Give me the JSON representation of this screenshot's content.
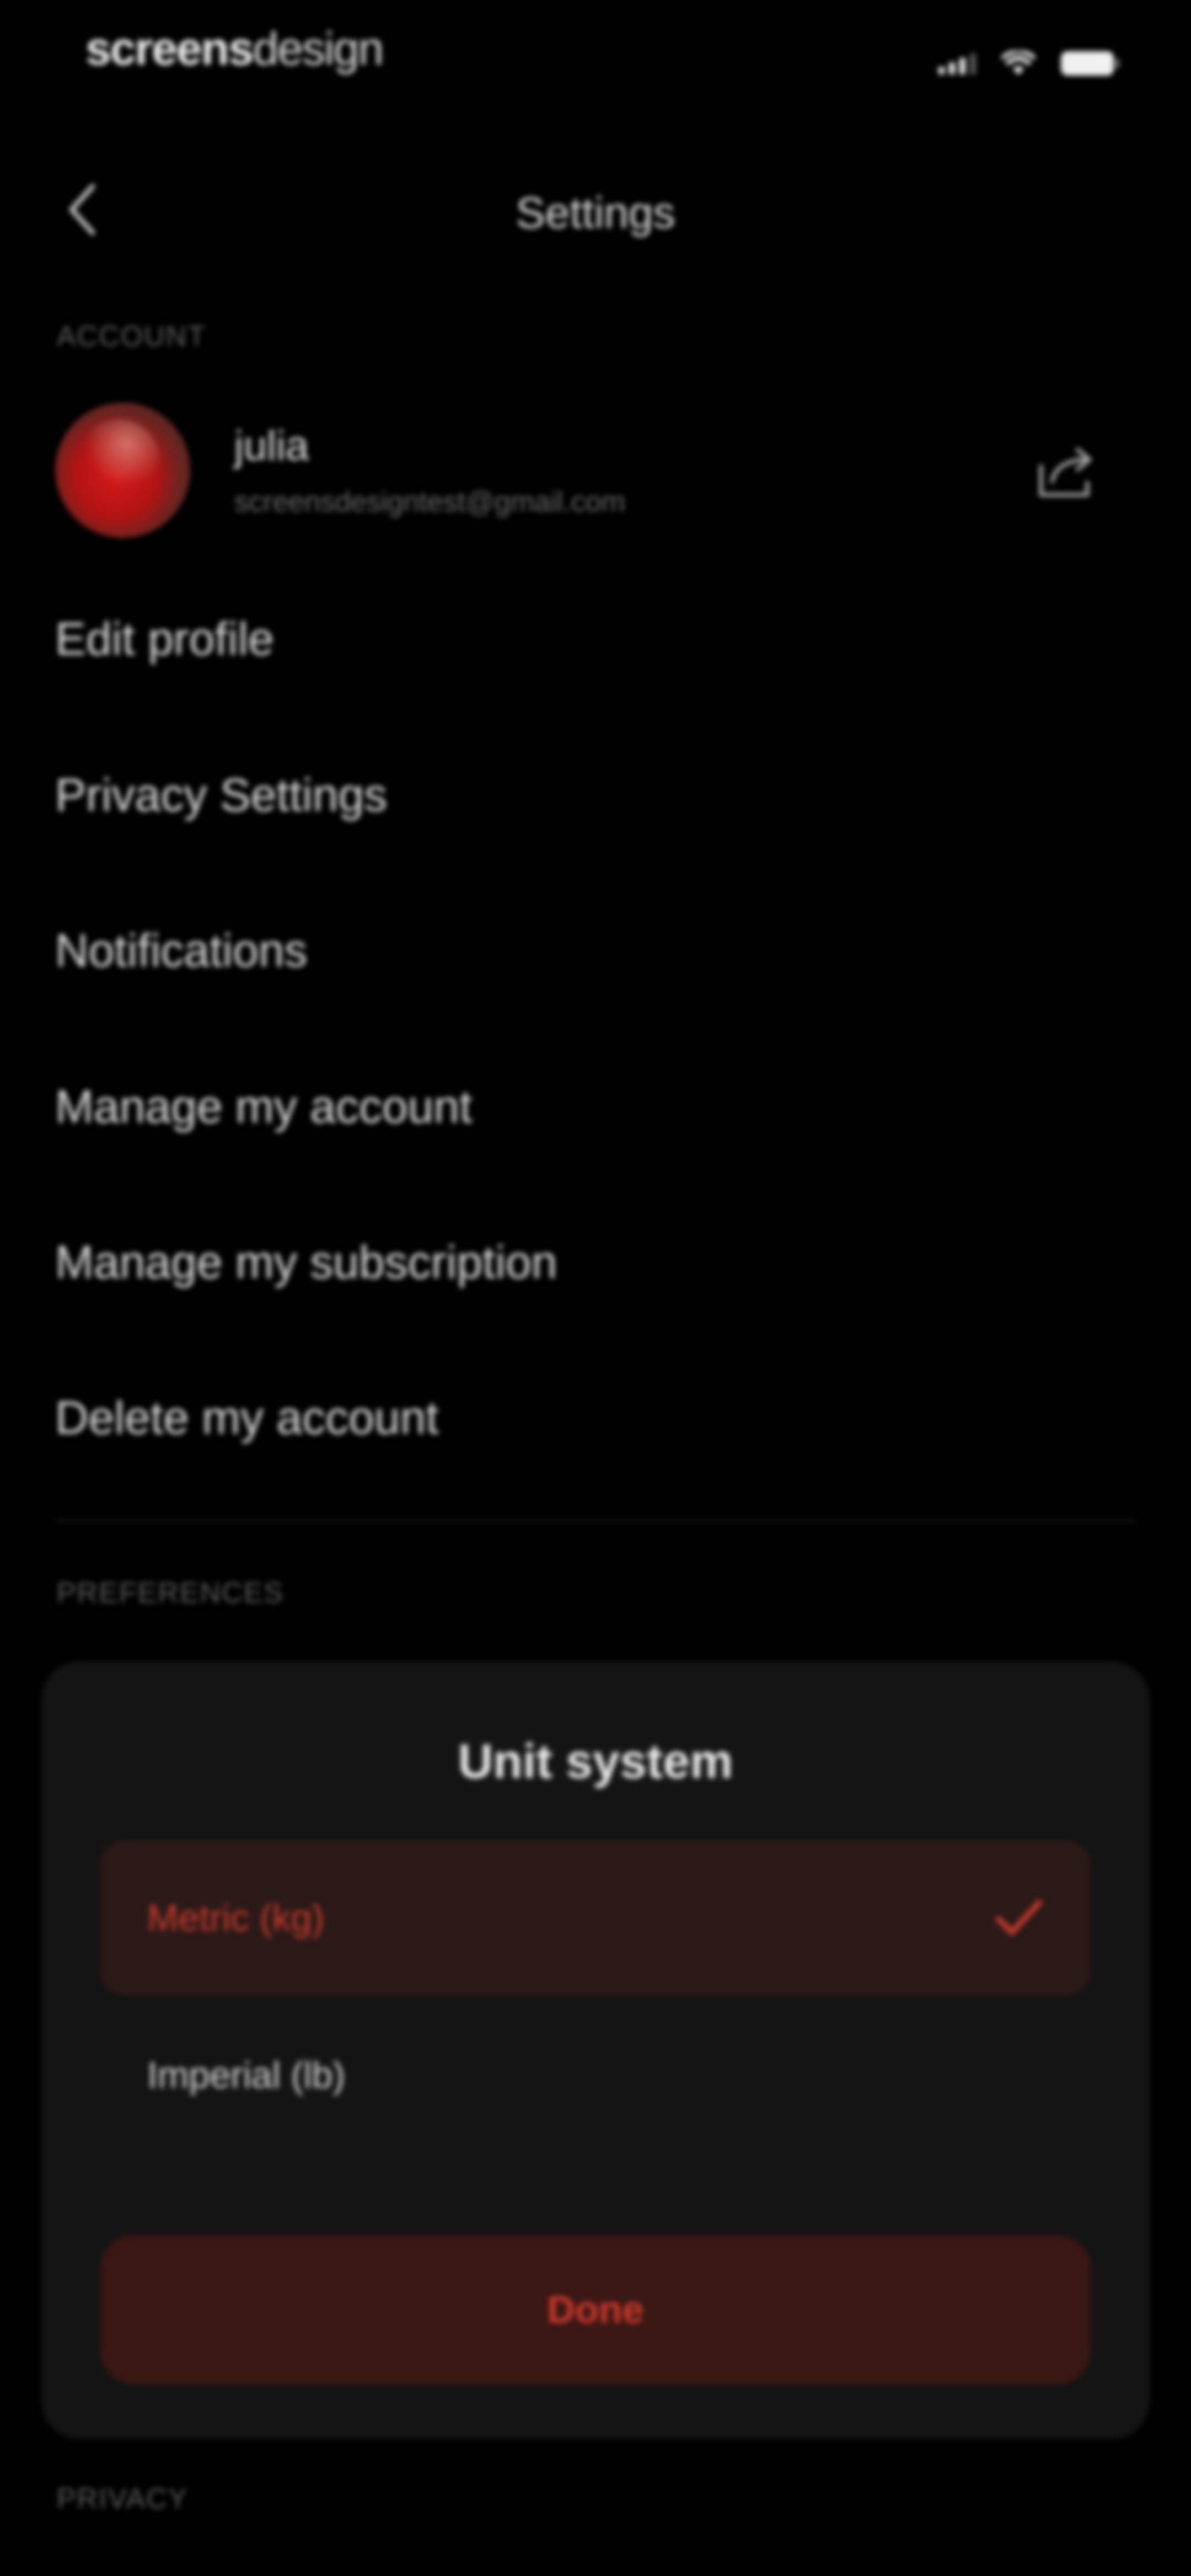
{
  "status_bar": {
    "brand_bold": "screens",
    "brand_regular": "design"
  },
  "nav": {
    "back_icon": "chevron-left-icon",
    "title": "Settings"
  },
  "sections": {
    "account_label": "ACCOUNT",
    "preferences_label": "PREFERENCES",
    "privacy_label": "PRIVACY"
  },
  "account": {
    "name": "julia",
    "email": "screensdesigntest@gmail.com",
    "share_icon": "share-icon"
  },
  "menu": {
    "items": [
      {
        "label": "Edit profile"
      },
      {
        "label": "Privacy Settings"
      },
      {
        "label": "Notifications"
      },
      {
        "label": "Manage my account"
      },
      {
        "label": "Manage my subscription"
      },
      {
        "label": "Delete my account"
      }
    ]
  },
  "unit_sheet": {
    "title": "Unit system",
    "options": [
      {
        "label": "Metric (kg)",
        "selected": true
      },
      {
        "label": "Imperial (lb)",
        "selected": false
      }
    ],
    "done_label": "Done"
  },
  "colors": {
    "background": "#000000",
    "sheet": "#141414",
    "accent": "#c73a2c",
    "selected_option_bg": "#2b1917",
    "done_button_bg": "#3a1713",
    "muted_text": "#5d5d5d"
  }
}
